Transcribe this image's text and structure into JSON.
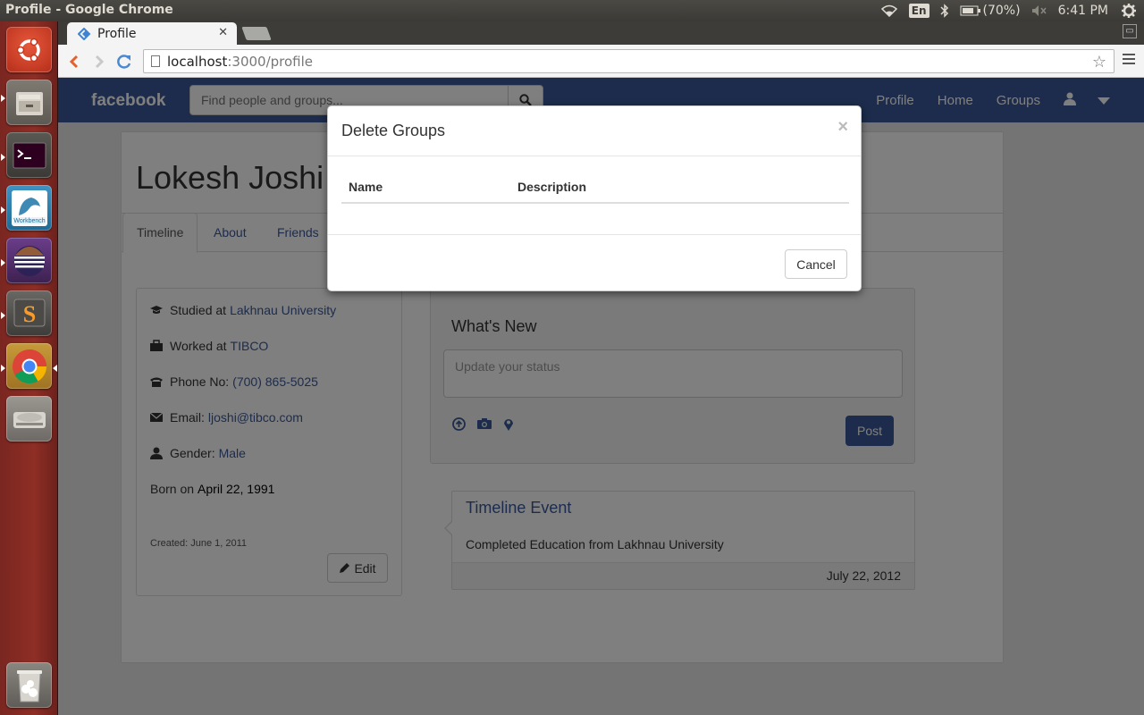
{
  "os": {
    "window_title": "Profile - Google Chrome",
    "keyboard_layout": "En",
    "battery": "(70%)",
    "clock": "6:41 PM"
  },
  "launcher": {
    "items": [
      "ubuntu-dash-icon",
      "files-icon",
      "terminal-icon",
      "mysql-workbench-icon",
      "eclipse-icon",
      "sublime-text-icon",
      "chrome-icon",
      "disk-icon",
      "trash-icon"
    ]
  },
  "browser": {
    "tab_title": "Profile",
    "url_host": "localhost",
    "url_path": ":3000/profile"
  },
  "navbar": {
    "brand": "facebook",
    "search_placeholder": "Find people and groups...",
    "links": [
      "Profile",
      "Home",
      "Groups"
    ]
  },
  "profile": {
    "name": "Lokesh Joshi",
    "tabs": [
      "Timeline",
      "About",
      "Friends"
    ],
    "info": {
      "studied_label": "Studied at",
      "studied_value": "Lakhnau University",
      "worked_label": "Worked at",
      "worked_value": "TIBCO",
      "phone_label": "Phone No:",
      "phone_value": "(700) 865-5025",
      "email_label": "Email:",
      "email_value": "ljoshi@tibco.com",
      "gender_label": "Gender:",
      "gender_value": "Male",
      "born_label": "Born on",
      "born_value": "April 22, 1991",
      "created": "Created: June 1, 2011",
      "edit_label": "Edit"
    },
    "whats_new": {
      "title": "What's New",
      "status_placeholder": "Update your status",
      "post_label": "Post"
    },
    "timeline_event": {
      "title": "Timeline Event",
      "body": "Completed Education from Lakhnau University",
      "date": "July 22, 2012"
    }
  },
  "modal": {
    "title": "Delete Groups",
    "close": "×",
    "columns": [
      "Name",
      "Description"
    ],
    "cancel_label": "Cancel"
  },
  "colors": {
    "brand_blue": "#3b5998",
    "launcher_red": "#8e2e25"
  }
}
